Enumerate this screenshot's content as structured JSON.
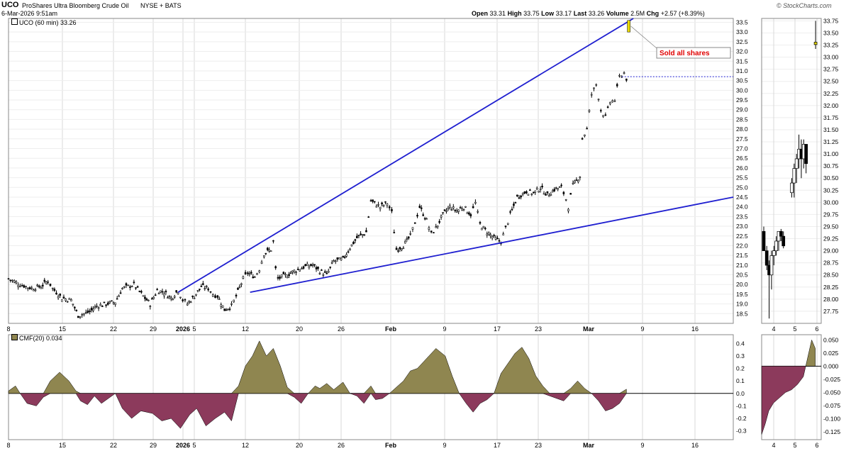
{
  "header": {
    "symbol": "UCO",
    "name": "ProShares Ultra Bloomberg Crude Oil",
    "exchange": "NYSE + BATS",
    "datetime": "6-Mar-2026 9:51am",
    "open_label": "Open",
    "open": "33.31",
    "high_label": "High",
    "high": "33.75",
    "low_label": "Low",
    "low": "33.17",
    "last_label": "Last",
    "last": "33.26",
    "volume_label": "Volume",
    "volume": "2.5M",
    "chg_label": "Chg",
    "chg": "+2.57 (+8.39%)",
    "brand": "© StockCharts.com"
  },
  "colors": {
    "trendline": "#1f1fd0",
    "cmf_positive": "#8f8650",
    "cmf_negative": "#8c3a5c",
    "annotation_text": "#e00000",
    "marker": "#e8d800",
    "grid": "#d8d8d8"
  },
  "chart_data": [
    {
      "type": "candlestick",
      "legend": "UCO (60 min) 33.26",
      "interval": "60 min",
      "x_ticks": [
        "8",
        "15",
        "22",
        "29",
        "2026",
        "5",
        "12",
        "20",
        "26",
        "Feb",
        "9",
        "17",
        "23",
        "Mar",
        "9",
        "16"
      ],
      "y_ticks": [
        "18.5",
        "19.0",
        "19.5",
        "20.0",
        "20.5",
        "21.0",
        "21.5",
        "22.0",
        "22.5",
        "23.0",
        "23.5",
        "24.0",
        "24.5",
        "25.0",
        "25.5",
        "26.0",
        "26.5",
        "27.0",
        "27.5",
        "28.0",
        "28.5",
        "29.0",
        "29.5",
        "30.0",
        "30.5",
        "31.0",
        "31.5",
        "32.0",
        "32.5",
        "33.0",
        "33.5"
      ],
      "ylim": [
        18.0,
        33.7
      ],
      "close_path": [
        {
          "x": 0,
          "y": 20.3
        },
        {
          "x": 5,
          "y": 20.0
        },
        {
          "x": 10,
          "y": 19.8
        },
        {
          "x": 14,
          "y": 19.9
        },
        {
          "x": 17,
          "y": 20.2
        },
        {
          "x": 19,
          "y": 19.8
        },
        {
          "x": 23,
          "y": 19.3
        },
        {
          "x": 27,
          "y": 19.2
        },
        {
          "x": 30,
          "y": 18.4
        },
        {
          "x": 35,
          "y": 18.6
        },
        {
          "x": 38,
          "y": 18.9
        },
        {
          "x": 42,
          "y": 19.0
        },
        {
          "x": 46,
          "y": 19.1
        },
        {
          "x": 49,
          "y": 19.8
        },
        {
          "x": 54,
          "y": 20.0
        },
        {
          "x": 58,
          "y": 19.4
        },
        {
          "x": 61,
          "y": 19.0
        },
        {
          "x": 64,
          "y": 19.7
        },
        {
          "x": 67,
          "y": 19.6
        },
        {
          "x": 70,
          "y": 19.3
        },
        {
          "x": 73,
          "y": 19.7
        },
        {
          "x": 75,
          "y": 19.2
        },
        {
          "x": 77,
          "y": 19.0
        },
        {
          "x": 80,
          "y": 19.4
        },
        {
          "x": 83,
          "y": 19.9
        },
        {
          "x": 86,
          "y": 19.8
        },
        {
          "x": 88,
          "y": 19.5
        },
        {
          "x": 90,
          "y": 19.4
        },
        {
          "x": 93,
          "y": 18.7
        },
        {
          "x": 96,
          "y": 18.9
        },
        {
          "x": 98,
          "y": 19.4
        },
        {
          "x": 101,
          "y": 20.3
        },
        {
          "x": 103,
          "y": 20.6
        },
        {
          "x": 106,
          "y": 20.4
        },
        {
          "x": 108,
          "y": 20.8
        },
        {
          "x": 110,
          "y": 21.6
        },
        {
          "x": 113,
          "y": 21.8
        },
        {
          "x": 114,
          "y": 22.2
        },
        {
          "x": 115,
          "y": 20.8
        },
        {
          "x": 116,
          "y": 20.3
        },
        {
          "x": 120,
          "y": 20.5
        },
        {
          "x": 123,
          "y": 20.7
        },
        {
          "x": 127,
          "y": 20.9
        },
        {
          "x": 131,
          "y": 21.0
        },
        {
          "x": 134,
          "y": 20.7
        },
        {
          "x": 137,
          "y": 20.5
        },
        {
          "x": 140,
          "y": 21.2
        },
        {
          "x": 144,
          "y": 21.3
        },
        {
          "x": 147,
          "y": 21.9
        },
        {
          "x": 150,
          "y": 22.4
        },
        {
          "x": 154,
          "y": 22.7
        },
        {
          "x": 156,
          "y": 24.3
        },
        {
          "x": 160,
          "y": 24.0
        },
        {
          "x": 163,
          "y": 24.2
        },
        {
          "x": 165,
          "y": 23.7
        },
        {
          "x": 167,
          "y": 21.8
        },
        {
          "x": 170,
          "y": 22.0
        },
        {
          "x": 173,
          "y": 22.5
        },
        {
          "x": 175,
          "y": 23.2
        },
        {
          "x": 177,
          "y": 24.0
        },
        {
          "x": 180,
          "y": 23.3
        },
        {
          "x": 182,
          "y": 22.6
        },
        {
          "x": 184,
          "y": 22.9
        },
        {
          "x": 187,
          "y": 23.6
        },
        {
          "x": 190,
          "y": 24.0
        },
        {
          "x": 193,
          "y": 23.8
        },
        {
          "x": 196,
          "y": 24.0
        },
        {
          "x": 199,
          "y": 23.6
        },
        {
          "x": 201,
          "y": 24.2
        },
        {
          "x": 203,
          "y": 23.1
        },
        {
          "x": 206,
          "y": 22.7
        },
        {
          "x": 209,
          "y": 22.4
        },
        {
          "x": 212,
          "y": 22.2
        },
        {
          "x": 214,
          "y": 22.9
        },
        {
          "x": 216,
          "y": 23.6
        },
        {
          "x": 219,
          "y": 24.5
        },
        {
          "x": 223,
          "y": 24.8
        },
        {
          "x": 226,
          "y": 24.7
        },
        {
          "x": 229,
          "y": 25.0
        },
        {
          "x": 232,
          "y": 24.6
        },
        {
          "x": 235,
          "y": 24.9
        },
        {
          "x": 238,
          "y": 25.0
        },
        {
          "x": 240,
          "y": 24.4
        },
        {
          "x": 241,
          "y": 24.0
        },
        {
          "x": 243,
          "y": 25.1
        },
        {
          "x": 246,
          "y": 25.6
        },
        {
          "x": 247,
          "y": 27.5
        },
        {
          "x": 249,
          "y": 28.0
        },
        {
          "x": 251,
          "y": 29.8
        },
        {
          "x": 253,
          "y": 30.3
        },
        {
          "x": 255,
          "y": 29.0
        },
        {
          "x": 257,
          "y": 28.6
        },
        {
          "x": 259,
          "y": 29.4
        },
        {
          "x": 261,
          "y": 29.5
        },
        {
          "x": 263,
          "y": 30.7
        },
        {
          "x": 265,
          "y": 30.9
        },
        {
          "x": 266,
          "y": 30.6
        },
        {
          "x": 267,
          "y": 33.26
        }
      ],
      "trendlines": [
        {
          "name": "upper",
          "from": {
            "x": 73,
            "y": 19.6
          },
          "to": {
            "x": 269,
            "y": 33.7
          }
        },
        {
          "name": "lower",
          "from": {
            "x": 104,
            "y": 19.6
          },
          "to": {
            "x": 312,
            "y": 24.5
          }
        }
      ],
      "reference_level": 30.7,
      "annotation": "Sold all shares"
    },
    {
      "type": "area",
      "legend": "CMF(20) 0.034",
      "x_ticks": [
        "8",
        "15",
        "22",
        "29",
        "2026",
        "5",
        "12",
        "20",
        "26",
        "Feb",
        "9",
        "17",
        "23",
        "Mar",
        "9",
        "16"
      ],
      "y_ticks": [
        "-0.3",
        "-0.2",
        "-0.1",
        "0.0",
        "0.1",
        "0.2",
        "0.3",
        "0.4"
      ],
      "ylim": [
        -0.37,
        0.47
      ],
      "values": [
        {
          "x": 0,
          "y": 0.02
        },
        {
          "x": 3,
          "y": 0.06
        },
        {
          "x": 5,
          "y": 0.0
        },
        {
          "x": 8,
          "y": -0.08
        },
        {
          "x": 12,
          "y": -0.1
        },
        {
          "x": 15,
          "y": -0.03
        },
        {
          "x": 18,
          "y": 0.1
        },
        {
          "x": 22,
          "y": 0.17
        },
        {
          "x": 26,
          "y": 0.1
        },
        {
          "x": 29,
          "y": 0.02
        },
        {
          "x": 31,
          "y": -0.06
        },
        {
          "x": 34,
          "y": -0.09
        },
        {
          "x": 37,
          "y": -0.02
        },
        {
          "x": 40,
          "y": -0.08
        },
        {
          "x": 43,
          "y": -0.04
        },
        {
          "x": 46,
          "y": 0.0
        },
        {
          "x": 49,
          "y": -0.12
        },
        {
          "x": 53,
          "y": -0.2
        },
        {
          "x": 57,
          "y": -0.14
        },
        {
          "x": 62,
          "y": -0.16
        },
        {
          "x": 66,
          "y": -0.22
        },
        {
          "x": 70,
          "y": -0.2
        },
        {
          "x": 74,
          "y": -0.28
        },
        {
          "x": 78,
          "y": -0.17
        },
        {
          "x": 81,
          "y": -0.12
        },
        {
          "x": 85,
          "y": -0.26
        },
        {
          "x": 89,
          "y": -0.2
        },
        {
          "x": 93,
          "y": -0.15
        },
        {
          "x": 96,
          "y": -0.22
        },
        {
          "x": 99,
          "y": 0.06
        },
        {
          "x": 102,
          "y": 0.22
        },
        {
          "x": 105,
          "y": 0.3
        },
        {
          "x": 108,
          "y": 0.42
        },
        {
          "x": 111,
          "y": 0.3
        },
        {
          "x": 114,
          "y": 0.36
        },
        {
          "x": 117,
          "y": 0.22
        },
        {
          "x": 120,
          "y": 0.05
        },
        {
          "x": 123,
          "y": -0.03
        },
        {
          "x": 126,
          "y": -0.08
        },
        {
          "x": 129,
          "y": 0.0
        },
        {
          "x": 132,
          "y": 0.06
        },
        {
          "x": 134,
          "y": 0.04
        },
        {
          "x": 137,
          "y": 0.08
        },
        {
          "x": 140,
          "y": 0.03
        },
        {
          "x": 144,
          "y": 0.09
        },
        {
          "x": 147,
          "y": 0.0
        },
        {
          "x": 150,
          "y": -0.02
        },
        {
          "x": 153,
          "y": -0.08
        },
        {
          "x": 156,
          "y": 0.06
        },
        {
          "x": 158,
          "y": -0.05
        },
        {
          "x": 161,
          "y": -0.04
        },
        {
          "x": 164,
          "y": 0.0
        },
        {
          "x": 167,
          "y": 0.05
        },
        {
          "x": 170,
          "y": 0.1
        },
        {
          "x": 173,
          "y": 0.18
        },
        {
          "x": 176,
          "y": 0.2
        },
        {
          "x": 180,
          "y": 0.28
        },
        {
          "x": 184,
          "y": 0.36
        },
        {
          "x": 188,
          "y": 0.3
        },
        {
          "x": 191,
          "y": 0.14
        },
        {
          "x": 194,
          "y": 0.0
        },
        {
          "x": 197,
          "y": -0.08
        },
        {
          "x": 200,
          "y": -0.15
        },
        {
          "x": 203,
          "y": -0.08
        },
        {
          "x": 206,
          "y": -0.05
        },
        {
          "x": 209,
          "y": 0.0
        },
        {
          "x": 212,
          "y": 0.16
        },
        {
          "x": 215,
          "y": 0.24
        },
        {
          "x": 218,
          "y": 0.32
        },
        {
          "x": 221,
          "y": 0.37
        },
        {
          "x": 224,
          "y": 0.28
        },
        {
          "x": 227,
          "y": 0.14
        },
        {
          "x": 230,
          "y": 0.06
        },
        {
          "x": 233,
          "y": -0.02
        },
        {
          "x": 236,
          "y": -0.04
        },
        {
          "x": 239,
          "y": -0.06
        },
        {
          "x": 242,
          "y": 0.04
        },
        {
          "x": 245,
          "y": 0.1
        },
        {
          "x": 248,
          "y": 0.04
        },
        {
          "x": 251,
          "y": 0.0
        },
        {
          "x": 254,
          "y": -0.06
        },
        {
          "x": 257,
          "y": -0.14
        },
        {
          "x": 260,
          "y": -0.12
        },
        {
          "x": 263,
          "y": -0.08
        },
        {
          "x": 266,
          "y": 0.034
        }
      ]
    },
    {
      "type": "candlestick",
      "panel": "intraday",
      "x_ticks": [
        "4",
        "5",
        "6"
      ],
      "y_ticks": [
        "27.75",
        "28.00",
        "28.25",
        "28.50",
        "28.75",
        "29.00",
        "29.25",
        "29.50",
        "29.75",
        "30.00",
        "30.25",
        "30.50",
        "30.75",
        "31.00",
        "31.25",
        "31.50",
        "31.75",
        "32.00",
        "32.25",
        "32.50",
        "32.75",
        "33.00",
        "33.25",
        "33.50",
        "33.75"
      ],
      "ylim": [
        27.5,
        33.8
      ],
      "candles": [
        {
          "x": 0.0,
          "o": 29.4,
          "h": 29.5,
          "l": 29.0,
          "c": 29.0
        },
        {
          "x": 0.05,
          "o": 29.0,
          "h": 29.1,
          "l": 28.6,
          "c": 28.7
        },
        {
          "x": 0.09,
          "o": 28.7,
          "h": 28.8,
          "l": 27.6,
          "c": 28.5
        },
        {
          "x": 0.13,
          "o": 28.5,
          "h": 29.0,
          "l": 28.2,
          "c": 28.9
        },
        {
          "x": 0.17,
          "o": 28.9,
          "h": 29.1,
          "l": 28.7,
          "c": 29.0
        },
        {
          "x": 0.21,
          "o": 29.0,
          "h": 29.3,
          "l": 28.9,
          "c": 29.2
        },
        {
          "x": 0.25,
          "o": 29.2,
          "h": 29.4,
          "l": 29.0,
          "c": 29.4
        },
        {
          "x": 0.29,
          "o": 29.4,
          "h": 29.45,
          "l": 29.2,
          "c": 29.3
        },
        {
          "x": 0.33,
          "o": 29.3,
          "h": 29.4,
          "l": 29.05,
          "c": 29.1
        },
        {
          "x": 0.47,
          "o": 30.2,
          "h": 30.5,
          "l": 30.1,
          "c": 30.4
        },
        {
          "x": 0.51,
          "o": 30.4,
          "h": 30.8,
          "l": 30.1,
          "c": 30.7
        },
        {
          "x": 0.55,
          "o": 30.7,
          "h": 31.0,
          "l": 30.4,
          "c": 30.9
        },
        {
          "x": 0.59,
          "o": 30.9,
          "h": 31.4,
          "l": 30.7,
          "c": 31.1
        },
        {
          "x": 0.63,
          "o": 31.1,
          "h": 31.3,
          "l": 30.5,
          "c": 30.9
        },
        {
          "x": 0.67,
          "o": 30.9,
          "h": 31.3,
          "l": 30.7,
          "c": 31.2
        },
        {
          "x": 0.71,
          "o": 31.2,
          "h": 31.2,
          "l": 30.6,
          "c": 30.8
        },
        {
          "x": 0.87,
          "o": 33.31,
          "h": 33.75,
          "l": 33.17,
          "c": 33.26
        }
      ]
    },
    {
      "type": "area",
      "panel": "intraday",
      "y_ticks": [
        "-0.125",
        "-0.100",
        "-0.075",
        "-0.050",
        "-0.025",
        "0.000",
        "0.025",
        "0.050"
      ],
      "ylim": [
        -0.14,
        0.06
      ],
      "values": [
        {
          "x": 0.0,
          "y": -0.13
        },
        {
          "x": 0.06,
          "y": -0.11
        },
        {
          "x": 0.12,
          "y": -0.085
        },
        {
          "x": 0.2,
          "y": -0.07
        },
        {
          "x": 0.3,
          "y": -0.06
        },
        {
          "x": 0.4,
          "y": -0.05
        },
        {
          "x": 0.5,
          "y": -0.045
        },
        {
          "x": 0.6,
          "y": -0.035
        },
        {
          "x": 0.7,
          "y": -0.02
        },
        {
          "x": 0.74,
          "y": 0.0
        },
        {
          "x": 0.8,
          "y": 0.03
        },
        {
          "x": 0.84,
          "y": 0.05
        },
        {
          "x": 0.9,
          "y": 0.034
        }
      ]
    }
  ]
}
